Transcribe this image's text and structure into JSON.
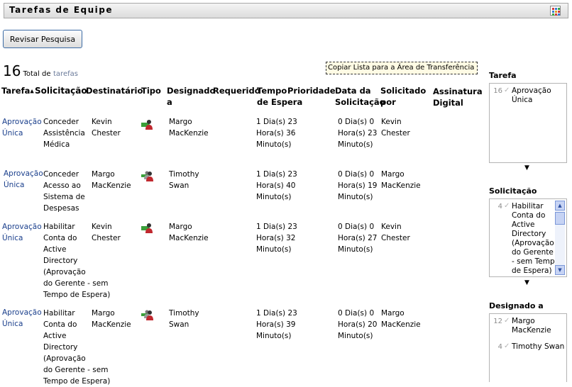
{
  "header": {
    "title": "Tarefas de Equipe",
    "grid_icon": "grid-icon"
  },
  "toolbar": {
    "revise_label": "Revisar Pesquisa",
    "copy_label": "Copiar Lista para a Área de Transferência"
  },
  "summary": {
    "count": "16",
    "label_total": "Total de",
    "label_tasks": "tarefas"
  },
  "columns": {
    "task": "Tarefa",
    "request": "Solicitação",
    "recipient": "Destinatário",
    "type": "Tipo",
    "assigned_1": "Designado",
    "assigned_2": "a",
    "required": "Requerido",
    "wait_1": "Tempo",
    "wait_2": "de Espera",
    "priority": "Prioridade",
    "reqdate_1": "Data da",
    "reqdate_2": "Solicitação",
    "reqby_1": "Solicitado",
    "reqby_2": "por",
    "signature_1": "Assinatura",
    "signature_2": "Digital"
  },
  "rows": [
    {
      "task": [
        "Aprovação",
        "Única"
      ],
      "request": [
        "Conceder",
        "Assistência",
        "Médica"
      ],
      "recipient": [
        "Kevin",
        "Chester"
      ],
      "type_icon": "single-user-task-icon",
      "assigned": [
        "Margo",
        "MacKenzie"
      ],
      "wait": [
        "1 Dia(s) 23",
        "Hora(s) 36",
        "Minuto(s)"
      ],
      "reqdate": [
        "0 Dia(s) 0",
        "Hora(s) 23",
        "Minuto(s)"
      ],
      "reqby": [
        "Kevin",
        "Chester"
      ]
    },
    {
      "task": [
        "Aprovação",
        "Única"
      ],
      "request": [
        "Conceder",
        "Acesso ao",
        "Sistema de",
        "Despesas"
      ],
      "recipient": [
        "Margo",
        "MacKenzie"
      ],
      "type_icon": "group-task-icon",
      "assigned": [
        "Timothy",
        "Swan"
      ],
      "wait": [
        "1 Dia(s) 23",
        "Hora(s) 40",
        "Minuto(s)"
      ],
      "reqdate": [
        "0 Dia(s) 0",
        "Hora(s) 19",
        "Minuto(s)"
      ],
      "reqby": [
        "Margo",
        "MacKenzie"
      ]
    },
    {
      "task": [
        "Aprovação",
        "Única"
      ],
      "request": [
        "Habilitar",
        "Conta do",
        "Active",
        "Directory",
        "(Aprovação",
        "do Gerente - sem",
        "Tempo de Espera)"
      ],
      "recipient": [
        "Kevin",
        "Chester"
      ],
      "type_icon": "single-user-task-icon",
      "assigned": [
        "Margo",
        "MacKenzie"
      ],
      "wait": [
        "1 Dia(s) 23",
        "Hora(s) 32",
        "Minuto(s)"
      ],
      "reqdate": [
        "0 Dia(s) 0",
        "Hora(s) 27",
        "Minuto(s)"
      ],
      "reqby": [
        "Kevin",
        "Chester"
      ]
    },
    {
      "task": [
        "Aprovação",
        "Única"
      ],
      "request": [
        "Habilitar",
        "Conta do",
        "Active",
        "Directory",
        "(Aprovação",
        "do Gerente - sem",
        "Tempo de Espera)"
      ],
      "recipient": [
        "Margo",
        "MacKenzie"
      ],
      "type_icon": "group-task-icon",
      "assigned": [
        "Timothy",
        "Swan"
      ],
      "wait": [
        "1 Dia(s) 23",
        "Hora(s) 39",
        "Minuto(s)"
      ],
      "reqdate": [
        "0 Dia(s) 0",
        "Hora(s) 20",
        "Minuto(s)"
      ],
      "reqby": [
        "Margo",
        "MacKenzie"
      ]
    }
  ],
  "sidebar": {
    "task_title": "Tarefa",
    "task_items": [
      {
        "count": "16",
        "label": [
          "Aprovação",
          "Única"
        ]
      }
    ],
    "request_title": "Solicitação",
    "request_items": [
      {
        "count": "4",
        "label": [
          "Habilitar",
          "Conta do",
          "Active",
          "Directory",
          "(Aprovação",
          "do Gerente",
          "- sem Tempo",
          "de Espera)"
        ]
      }
    ],
    "assigned_title": "Designado a",
    "assigned_items": [
      {
        "count": "12",
        "label": [
          "Margo",
          "MacKenzie"
        ]
      },
      {
        "count": "4",
        "label": [
          "Timothy Swan"
        ]
      }
    ],
    "check_glyph": "✓",
    "dropdown_glyph": "▼"
  },
  "colors": {
    "link": "#1a3f8c",
    "accent_blue": "#3b6ba5"
  }
}
